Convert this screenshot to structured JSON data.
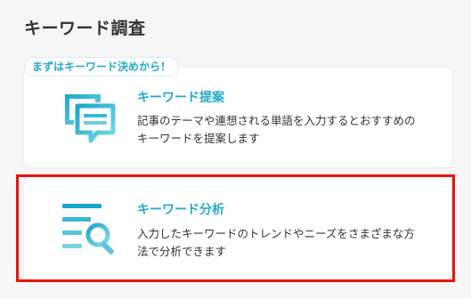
{
  "page": {
    "title": "キーワード調査"
  },
  "badge": {
    "label": "まずはキーワード決めから！"
  },
  "cards": [
    {
      "icon": "chat-bubbles-icon",
      "title": "キーワード提案",
      "description": "記事のテーマや連想される単語を入力するとおすすめのキーワードを提案します"
    },
    {
      "icon": "search-list-icon",
      "title": "キーワード分析",
      "description": "入力したキーワードのトレンドやニーズをさまざまな方法で分析できます"
    }
  ],
  "colors": {
    "accent": "#22aacb",
    "highlight": "#e8140c",
    "background": "#f6f6f7"
  }
}
